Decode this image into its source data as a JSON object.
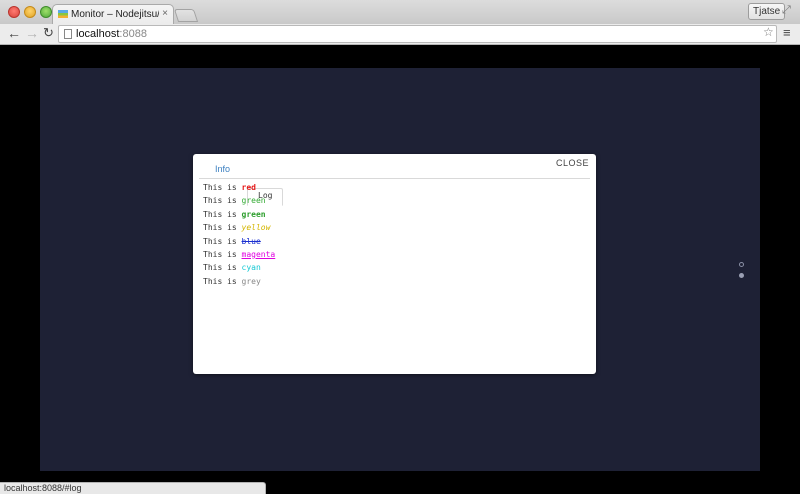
{
  "browser": {
    "tab": {
      "title": "Monitor – Nodejitsu/forev",
      "close": "×"
    },
    "profile": "Tjatse",
    "nav": {
      "back": "←",
      "forward": "→",
      "reload": "↻"
    },
    "url": {
      "host": "localhost",
      "port": ":8088"
    },
    "star": "☆",
    "menu": "≡",
    "status": "localhost:8088/#log"
  },
  "modal": {
    "close_label": "CLOSE",
    "tabs": [
      {
        "label": "Info"
      },
      {
        "label": "Log"
      }
    ],
    "active_tab": "Log",
    "log_prefix": "This is ",
    "log_lines": [
      {
        "text": "red"
      },
      {
        "text": "green"
      },
      {
        "text": "green"
      },
      {
        "text": "yellow"
      },
      {
        "text": "blue"
      },
      {
        "text": "magenta"
      },
      {
        "text": "cyan"
      },
      {
        "text": "grey"
      }
    ]
  },
  "colors": {
    "app_background": "#1e2135",
    "red": "#e51a1a",
    "green": "#33aa33",
    "yellow": "#d4b600",
    "blue": "#1a2fd0",
    "magenta": "#e000e0",
    "cyan": "#16c9d4",
    "grey": "#888888",
    "tab_info": "#3b7fc0"
  },
  "pager": {
    "dots": 2,
    "active_index": 1
  }
}
